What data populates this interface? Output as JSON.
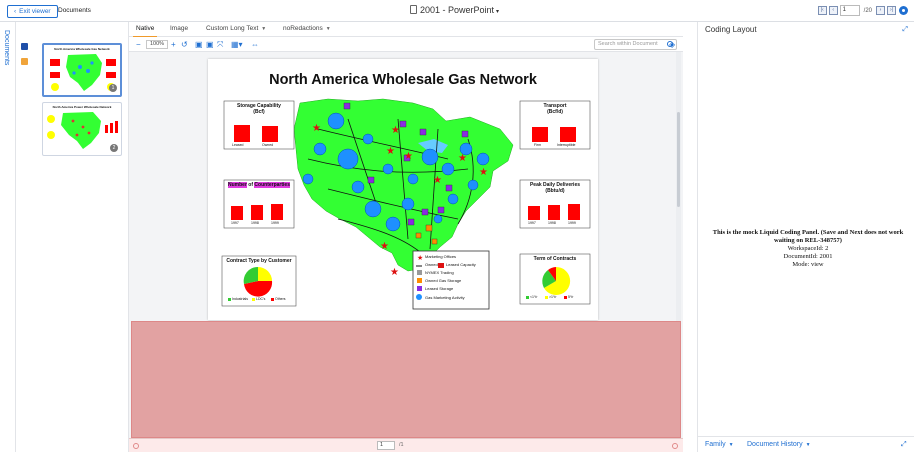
{
  "header": {
    "exit_label": "Exit viewer",
    "breadcrumb": "Documents",
    "doc_title": "2001 - PowerPoint",
    "page_input": "1",
    "page_total": "/20"
  },
  "rail": {
    "label": "Documents"
  },
  "thumbnails": [
    {
      "title": "North America Wholesale Gas Network",
      "badge": "1"
    },
    {
      "title": "North America Power Wholesale Network",
      "badge": "2"
    }
  ],
  "viewer": {
    "tabs": [
      {
        "label": "Native",
        "active": true
      },
      {
        "label": "Image"
      },
      {
        "label": "Custom Long Text"
      },
      {
        "label": "noRedactions"
      }
    ],
    "zoom": "100%",
    "search_placeholder": "Search within Document",
    "bottom_page_input": "1",
    "bottom_page_total": "/1"
  },
  "slide": {
    "title": "North America Wholesale Gas Network",
    "panels": {
      "storage": {
        "title": "Storage Capability",
        "unit": "(Bcf)",
        "labels": [
          "Leased",
          "Owned"
        ],
        "values": [
          0.62,
          0.58
        ]
      },
      "transport": {
        "title": "Transport",
        "unit": "(Bcf/d)",
        "labels": [
          "Firm",
          "Interruptible"
        ],
        "values": [
          0.55,
          0.55
        ]
      },
      "counterparties": {
        "title_part1": "Number",
        "title_part2": "of",
        "title_part3": "Counterparties",
        "labels": [
          "1997",
          "1998",
          "1999"
        ],
        "values": [
          0.5,
          0.55,
          0.6
        ]
      },
      "peak": {
        "title": "Peak Daily Deliveries",
        "unit": "(Bbtu/d)",
        "labels": [
          "1997",
          "1998",
          "1999"
        ],
        "values": [
          0.5,
          0.55,
          0.6
        ]
      },
      "contract": {
        "title": "Contract Type by Customer",
        "legend": [
          "Industrials",
          "LDC's",
          "Others"
        ]
      },
      "term": {
        "title": "Term of Contracts",
        "legend": [
          "<1Yr",
          ">1Yr",
          "5Yr"
        ]
      }
    },
    "legend": {
      "items": [
        "Marketing Offices",
        "Owned",
        "Leased Capacity",
        "NYMEX Trading",
        "Owned Gas Storage",
        "Leased Storage",
        "Gas Marketing Activity"
      ]
    }
  },
  "right_panel": {
    "title": "Coding Layout",
    "message_bold": "This is the mock Liquid Coding Panel. (Save and Next does not work waiting on REL-348757)",
    "workspace": "WorkspaceId: 2",
    "document": "DocumentId: 2001",
    "mode": "Mode: view",
    "footer_links": [
      "Family",
      "Document History"
    ]
  },
  "colors": {
    "accent": "#1f6fd1",
    "tab_active": "#f09a2a",
    "redaction": "#e2a2a2",
    "map_land": "#33ff33",
    "bar_red": "#ff0000",
    "marker_blue": "#1e90ff"
  }
}
